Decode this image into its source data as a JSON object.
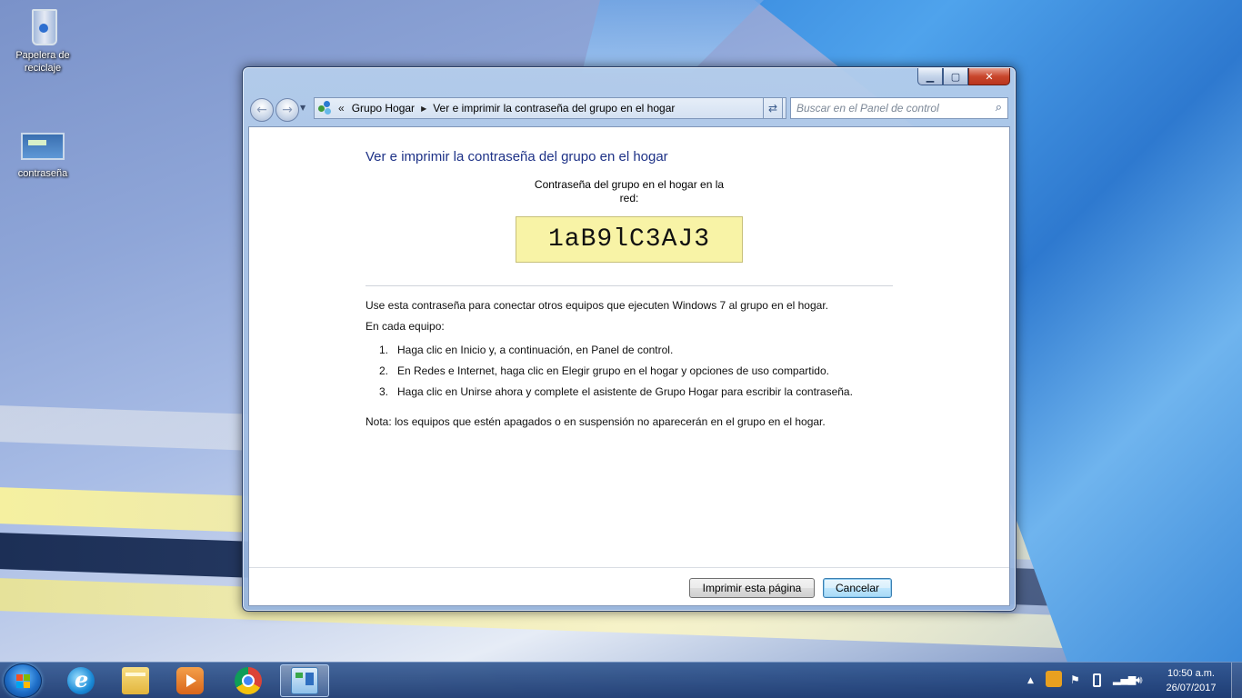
{
  "desktop": {
    "icons": [
      {
        "label": "Papelera de reciclaje"
      },
      {
        "label": "contraseña"
      }
    ]
  },
  "window": {
    "controls": {
      "minimize": "▁",
      "maximize": "▢",
      "close": "✕"
    },
    "address": {
      "overflow": "«",
      "crumb1": "Grupo Hogar",
      "crumb2": "Ver e imprimir la contraseña del grupo en el hogar"
    },
    "search_placeholder": "Buscar en el Panel de control",
    "title": "Ver e imprimir la contraseña del grupo en el hogar",
    "password_label": "Contraseña del grupo en el hogar en la red:",
    "password": "1aB9lC3AJ3",
    "intro": "Use esta contraseña para conectar otros equipos que ejecuten Windows 7 al grupo en el hogar.",
    "each_pc": "En cada equipo:",
    "steps": [
      {
        "num": "1.",
        "text": "Haga clic en Inicio y, a continuación, en Panel de control."
      },
      {
        "num": "2.",
        "text": "En Redes e Internet, haga clic en Elegir grupo en el hogar y opciones de uso compartido."
      },
      {
        "num": "3.",
        "text": "Haga clic en Unirse ahora y complete el asistente de Grupo Hogar para escribir la contraseña."
      }
    ],
    "note": "Nota: los equipos que estén apagados o en suspensión no aparecerán en el grupo en el hogar.",
    "buttons": {
      "print": "Imprimir esta página",
      "cancel": "Cancelar"
    }
  },
  "taskbar": {
    "apps": [
      "internet-explorer",
      "windows-explorer",
      "media-player",
      "chrome",
      "control-panel"
    ],
    "clock": {
      "time": "10:50 a.m.",
      "date": "26/07/2017"
    }
  }
}
